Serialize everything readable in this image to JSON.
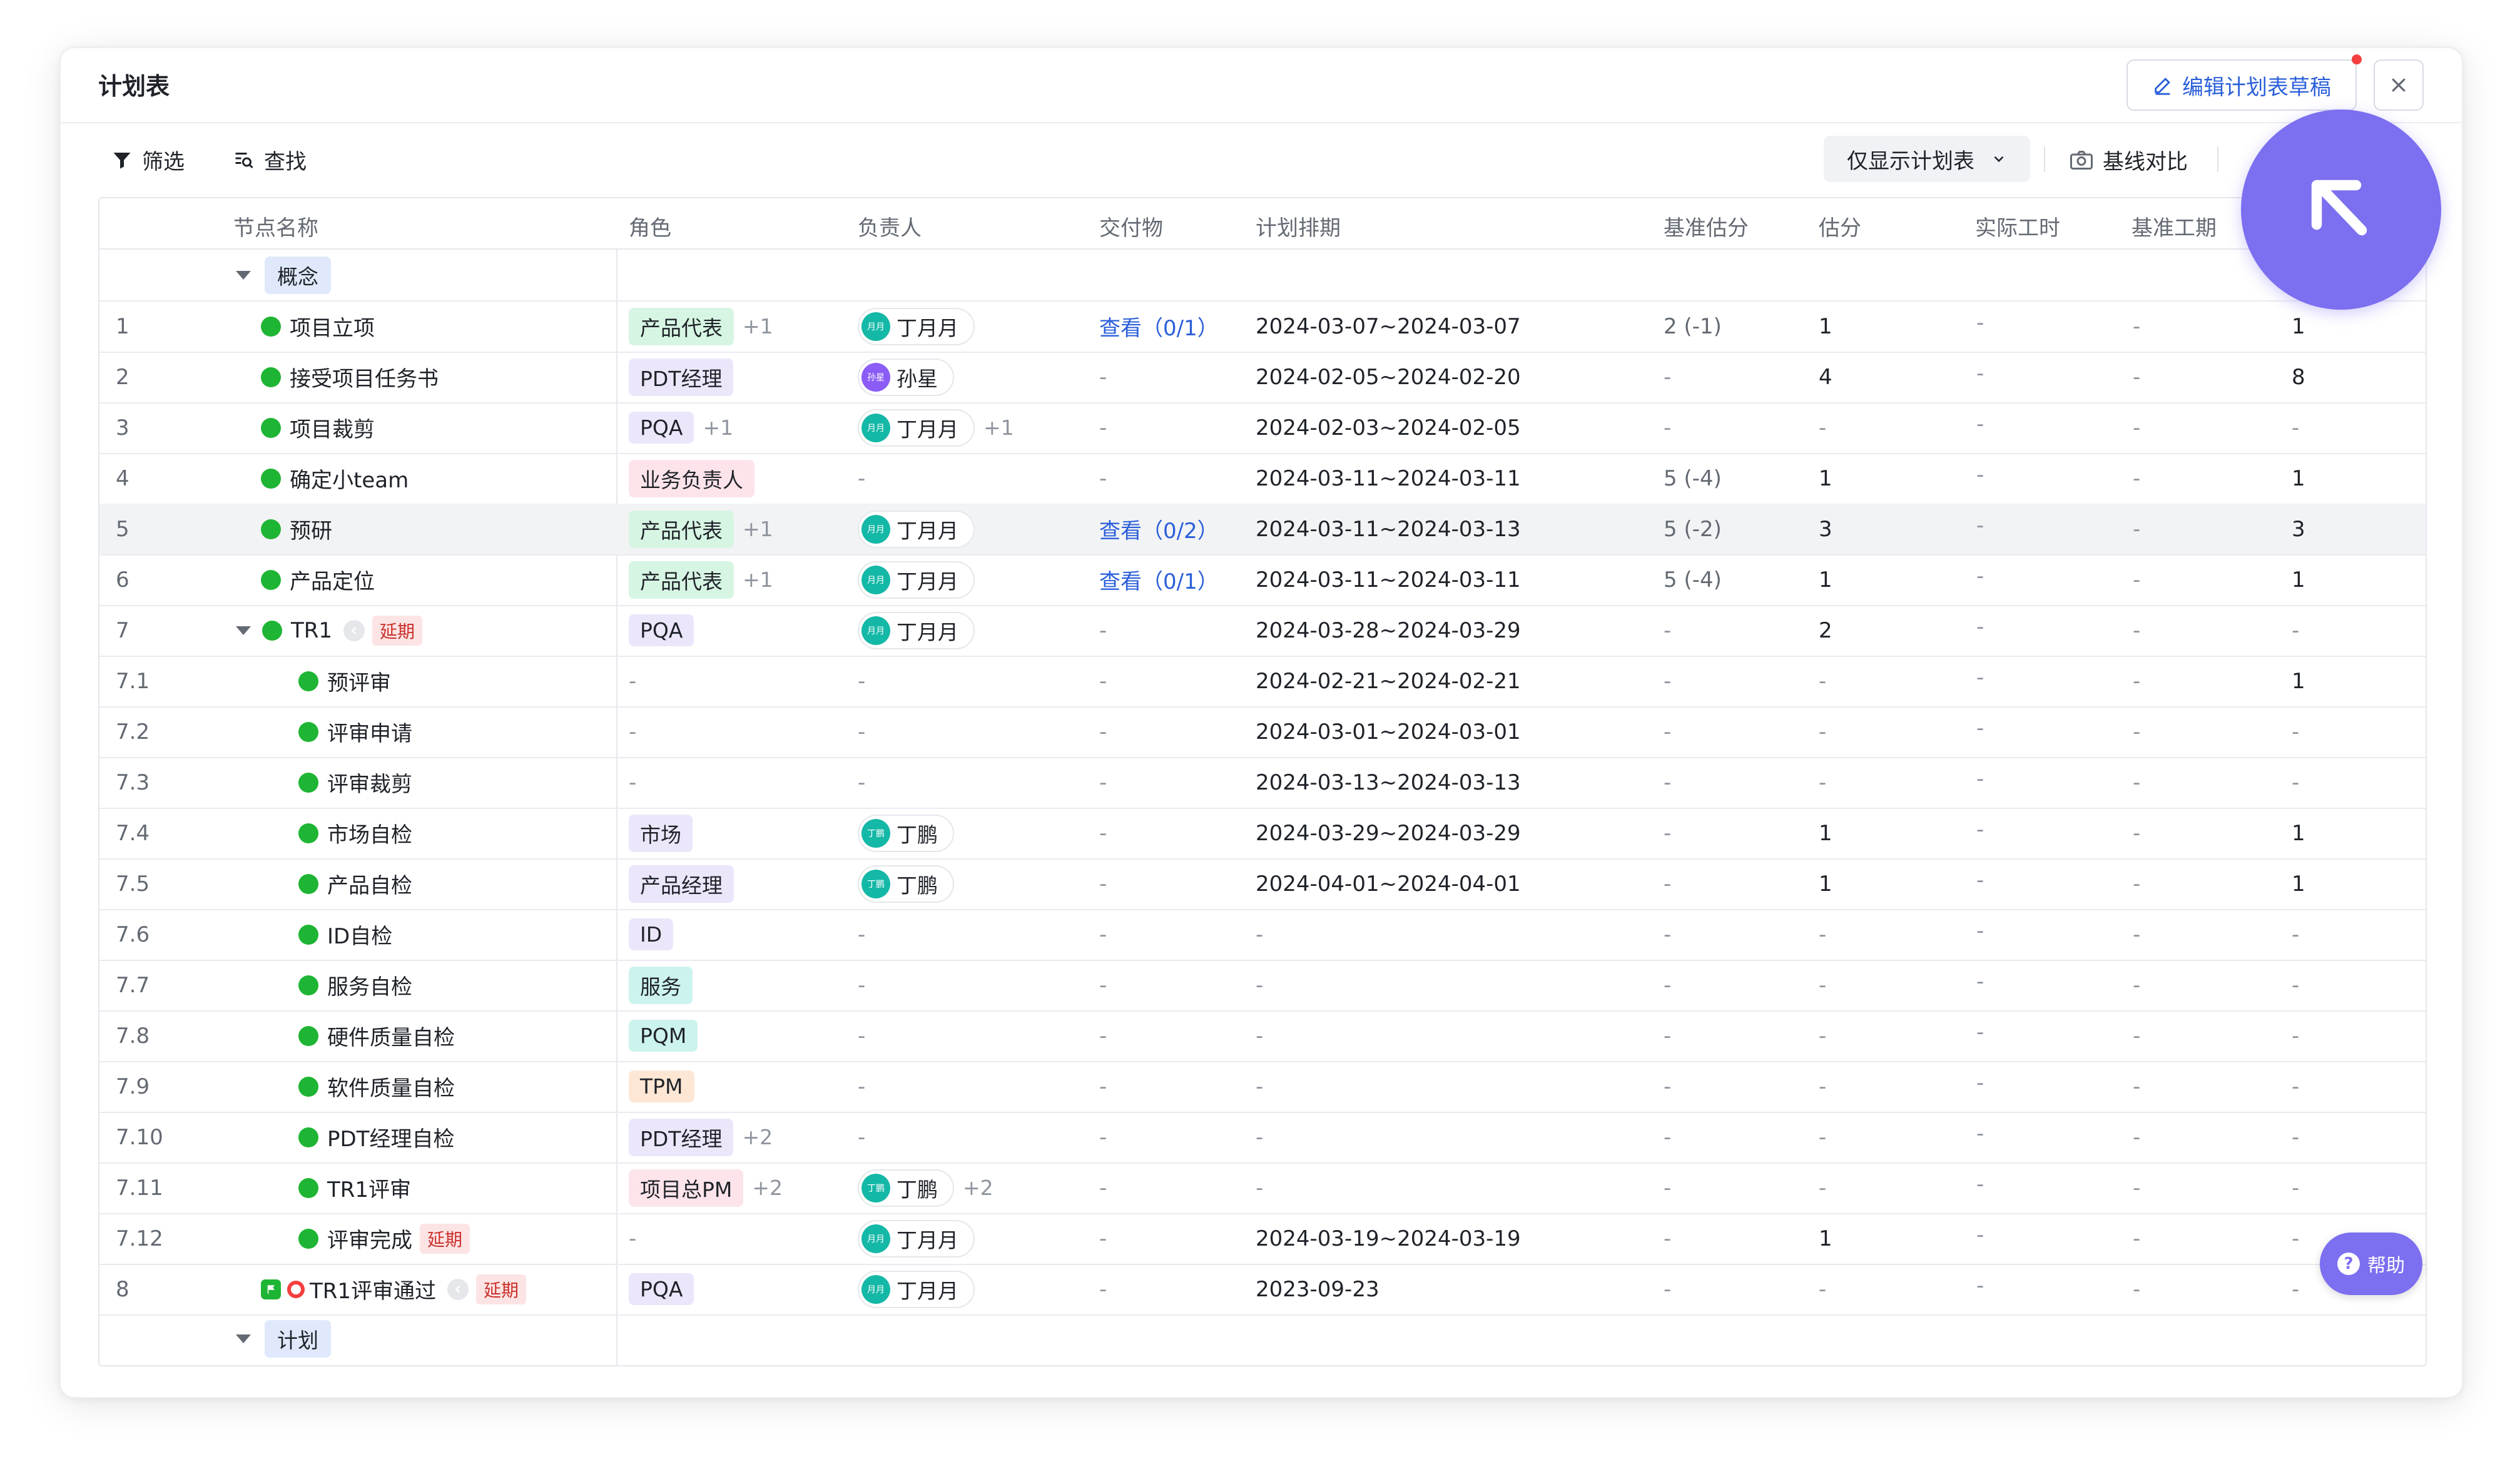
{
  "header": {
    "title": "计划表",
    "edit_label": "编辑计划表草稿"
  },
  "toolbar": {
    "filter_label": "筛选",
    "find_label": "查找",
    "only_plan_label": "仅显示计划表",
    "baseline_label": "基线对比"
  },
  "columns": [
    "节点名称",
    "角色",
    "负责人",
    "交付物",
    "计划排期",
    "基准估分",
    "估分",
    "实际工时",
    "基准工期"
  ],
  "groups": [
    {
      "label": "概念"
    },
    {
      "label": "计划"
    }
  ],
  "rows": [
    {
      "num": "1",
      "name": "项目立项",
      "role": "产品代表",
      "role_more": "+1",
      "owner": "丁月月",
      "owner_more": "",
      "deliv": "查看（0/1）",
      "sched": "2024-03-07~2024-03-07",
      "base": "2 (-1)",
      "score": "1",
      "work": "-",
      "dur": "-",
      "last": "1"
    },
    {
      "num": "2",
      "name": "接受项目任务书",
      "role": "PDT经理",
      "role_more": "",
      "owner": "孙星",
      "owner_more": "",
      "deliv": "-",
      "sched": "2024-02-05~2024-02-20",
      "base": "-",
      "score": "4",
      "work": "-",
      "dur": "-",
      "last": "8"
    },
    {
      "num": "3",
      "name": "项目裁剪",
      "role": "PQA",
      "role_more": "+1",
      "owner": "丁月月",
      "owner_more": "+1",
      "deliv": "-",
      "sched": "2024-02-03~2024-02-05",
      "base": "-",
      "score": "-",
      "work": "-",
      "dur": "-",
      "last": "-"
    },
    {
      "num": "4",
      "name": "确定小team",
      "role": "业务负责人",
      "role_more": "",
      "owner": "-",
      "owner_more": "",
      "deliv": "-",
      "sched": "2024-03-11~2024-03-11",
      "base": "5 (-4)",
      "score": "1",
      "work": "-",
      "dur": "-",
      "last": "1"
    },
    {
      "num": "5",
      "name": "预研",
      "role": "产品代表",
      "role_more": "+1",
      "owner": "丁月月",
      "owner_more": "",
      "deliv": "查看（0/2）",
      "sched": "2024-03-11~2024-03-13",
      "base": "5 (-2)",
      "score": "3",
      "work": "-",
      "dur": "-",
      "last": "3"
    },
    {
      "num": "6",
      "name": "产品定位",
      "role": "产品代表",
      "role_more": "+1",
      "owner": "丁月月",
      "owner_more": "",
      "deliv": "查看（0/1）",
      "sched": "2024-03-11~2024-03-11",
      "base": "5 (-4)",
      "score": "1",
      "work": "-",
      "dur": "-",
      "last": "1"
    },
    {
      "num": "7",
      "name": "TR1",
      "delay": "延期",
      "role": "PQA",
      "role_more": "",
      "owner": "丁月月",
      "owner_more": "",
      "deliv": "-",
      "sched": "2024-03-28~2024-03-29",
      "base": "-",
      "score": "2",
      "work": "-",
      "dur": "-",
      "last": "-"
    },
    {
      "num": "7.1",
      "name": "预评审",
      "role": "-",
      "role_more": "",
      "owner": "-",
      "owner_more": "",
      "deliv": "-",
      "sched": "2024-02-21~2024-02-21",
      "base": "-",
      "score": "-",
      "work": "-",
      "dur": "-",
      "last": "1"
    },
    {
      "num": "7.2",
      "name": "评审申请",
      "role": "-",
      "role_more": "",
      "owner": "-",
      "owner_more": "",
      "deliv": "-",
      "sched": "2024-03-01~2024-03-01",
      "base": "-",
      "score": "-",
      "work": "-",
      "dur": "-",
      "last": "-"
    },
    {
      "num": "7.3",
      "name": "评审裁剪",
      "role": "-",
      "role_more": "",
      "owner": "-",
      "owner_more": "",
      "deliv": "-",
      "sched": "2024-03-13~2024-03-13",
      "base": "-",
      "score": "-",
      "work": "-",
      "dur": "-",
      "last": "-"
    },
    {
      "num": "7.4",
      "name": "市场自检",
      "role": "市场",
      "role_more": "",
      "owner": "丁鹏",
      "owner_more": "",
      "deliv": "-",
      "sched": "2024-03-29~2024-03-29",
      "base": "-",
      "score": "1",
      "work": "-",
      "dur": "-",
      "last": "1"
    },
    {
      "num": "7.5",
      "name": "产品自检",
      "role": "产品经理",
      "role_more": "",
      "owner": "丁鹏",
      "owner_more": "",
      "deliv": "-",
      "sched": "2024-04-01~2024-04-01",
      "base": "-",
      "score": "1",
      "work": "-",
      "dur": "-",
      "last": "1"
    },
    {
      "num": "7.6",
      "name": "ID自检",
      "role": "ID",
      "role_more": "",
      "owner": "-",
      "owner_more": "",
      "deliv": "-",
      "sched": "-",
      "base": "-",
      "score": "-",
      "work": "-",
      "dur": "-",
      "last": "-"
    },
    {
      "num": "7.7",
      "name": "服务自检",
      "role": "服务",
      "role_more": "",
      "owner": "-",
      "owner_more": "",
      "deliv": "-",
      "sched": "-",
      "base": "-",
      "score": "-",
      "work": "-",
      "dur": "-",
      "last": "-"
    },
    {
      "num": "7.8",
      "name": "硬件质量自检",
      "role": "PQM",
      "role_more": "",
      "owner": "-",
      "owner_more": "",
      "deliv": "-",
      "sched": "-",
      "base": "-",
      "score": "-",
      "work": "-",
      "dur": "-",
      "last": "-"
    },
    {
      "num": "7.9",
      "name": "软件质量自检",
      "role": "TPM",
      "role_more": "",
      "owner": "-",
      "owner_more": "",
      "deliv": "-",
      "sched": "-",
      "base": "-",
      "score": "-",
      "work": "-",
      "dur": "-",
      "last": "-"
    },
    {
      "num": "7.10",
      "name": "PDT经理自检",
      "role": "PDT经理",
      "role_more": "+2",
      "owner": "-",
      "owner_more": "",
      "deliv": "-",
      "sched": "-",
      "base": "-",
      "score": "-",
      "work": "-",
      "dur": "-",
      "last": "-"
    },
    {
      "num": "7.11",
      "name": "TR1评审",
      "role": "项目总PM",
      "role_more": "+2",
      "owner": "丁鹏",
      "owner_more": "+2",
      "deliv": "-",
      "sched": "-",
      "base": "-",
      "score": "-",
      "work": "-",
      "dur": "-",
      "last": "-"
    },
    {
      "num": "7.12",
      "name": "评审完成",
      "delay": "延期",
      "role": "-",
      "role_more": "",
      "owner": "丁月月",
      "owner_more": "",
      "deliv": "-",
      "sched": "2024-03-19~2024-03-19",
      "base": "-",
      "score": "1",
      "work": "-",
      "dur": "-",
      "last": "-"
    },
    {
      "num": "8",
      "name": "TR1评审通过",
      "delay": "延期",
      "role": "PQA",
      "role_more": "",
      "owner": "丁月月",
      "owner_more": "",
      "deliv": "-",
      "sched": "2023-09-23",
      "base": "-",
      "score": "-",
      "work": "-",
      "dur": "-",
      "last": "-"
    }
  ],
  "avatars": {
    "dingyueyue": "月月",
    "sunxing": "孙星",
    "dingpeng": "丁鹏"
  },
  "help_label": "帮助",
  "colors": {
    "accent": "#2b5fd9",
    "fab": "#7c6ff0",
    "status_green": "#1fb534",
    "delay_red": "#c9302c"
  },
  "icons": [
    "filter-icon",
    "find-icon",
    "edit-icon",
    "close-icon",
    "camera-icon",
    "chevron-down-icon",
    "arrow-up-left-icon",
    "help-icon",
    "undo-icon",
    "milestone-flag-icon"
  ]
}
